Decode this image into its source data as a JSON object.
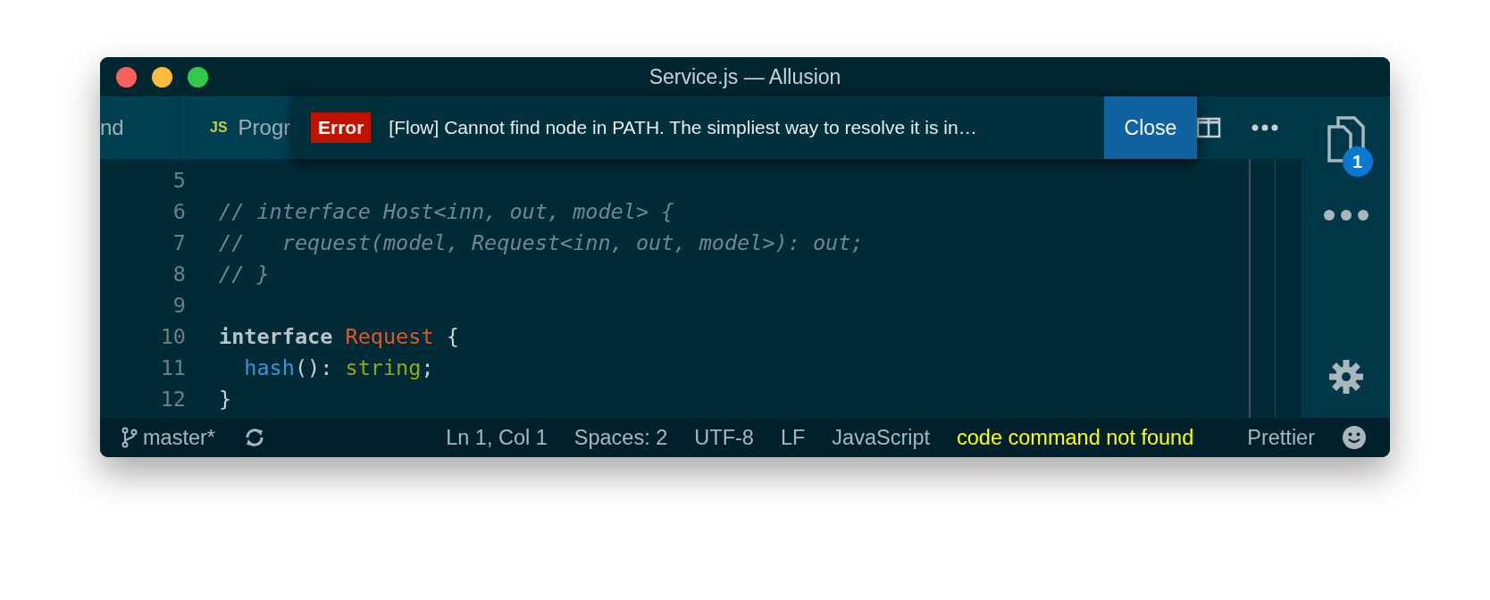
{
  "window": {
    "title": "Service.js — Allusion"
  },
  "tabs": [
    {
      "label": "nd"
    },
    {
      "label": "Progr",
      "icon": "JS"
    }
  ],
  "notification": {
    "severity": "Error",
    "message": "[Flow] Cannot find node in PATH. The simpliest way to resolve it is in…",
    "button": "Close"
  },
  "editor": {
    "lines": [
      {
        "number": "5"
      },
      {
        "number": "6",
        "tokens": [
          {
            "kind": "comment",
            "text": "// interface Host<inn, out, model> {"
          }
        ]
      },
      {
        "number": "7",
        "tokens": [
          {
            "kind": "comment",
            "text": "//   request(model, Request<inn, out, model>): out;"
          }
        ]
      },
      {
        "number": "8",
        "tokens": [
          {
            "kind": "comment",
            "text": "// }"
          }
        ]
      },
      {
        "number": "9"
      },
      {
        "number": "10",
        "tokens": [
          {
            "kind": "keyword",
            "text": "interface"
          },
          {
            "kind": "type",
            "text": "Request"
          },
          {
            "kind": "brace",
            "text": "{"
          }
        ]
      },
      {
        "number": "11",
        "tokens": [
          {
            "kind": "function",
            "text": "  hash"
          },
          {
            "kind": "punct",
            "text": "():"
          },
          {
            "kind": "builtin",
            "text": "string"
          },
          {
            "kind": "punct",
            "text": ";"
          }
        ]
      },
      {
        "number": "12",
        "tokens": [
          {
            "kind": "brace",
            "text": "}"
          }
        ]
      }
    ]
  },
  "activity_bar": {
    "badge": "1"
  },
  "status_bar": {
    "branch": "master*",
    "items": [
      {
        "text": "Ln 1, Col 1",
        "kind": "normal"
      },
      {
        "text": "Spaces: 2",
        "kind": "normal"
      },
      {
        "text": "UTF-8",
        "kind": "normal"
      },
      {
        "text": "LF",
        "kind": "normal"
      },
      {
        "text": "JavaScript",
        "kind": "normal"
      },
      {
        "text": "code command not found",
        "kind": "warning"
      },
      {
        "text": "Prettier",
        "kind": "normal"
      }
    ]
  }
}
